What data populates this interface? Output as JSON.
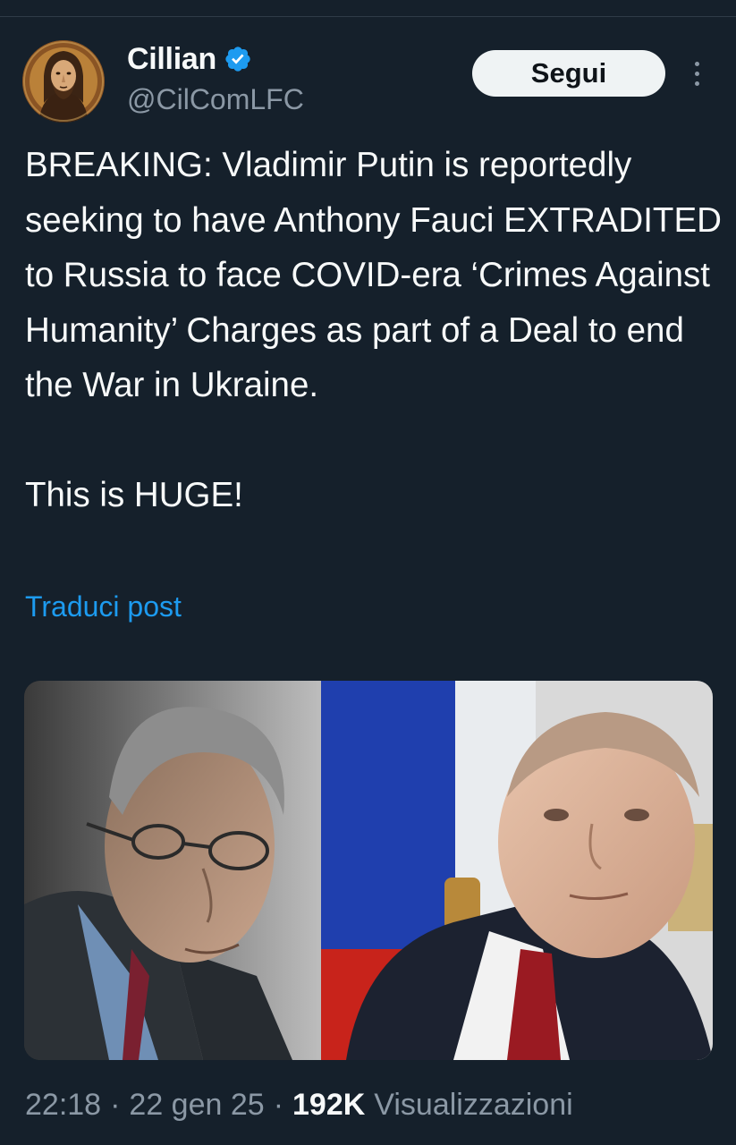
{
  "author": {
    "display_name": "Cillian",
    "handle": "@CilComLFC",
    "verified": true
  },
  "actions": {
    "follow_label": "Segui"
  },
  "post": {
    "text": "BREAKING: Vladimir Putin is reportedly seeking to have Anthony Fauci EXTRADITED to Russia to face COVID-era ‘Crimes Against Humanity’ Charges as part of a Deal to end the War in Ukraine.\n\nThis is HUGE!",
    "translate_label": "Traduci post"
  },
  "meta": {
    "time": "22:18",
    "date": "22 gen 25",
    "views_count": "192K",
    "views_label": "Visualizzazioni",
    "separator": "·"
  },
  "colors": {
    "background": "#15202b",
    "text_primary": "#f7f9f9",
    "text_secondary": "#8b98a5",
    "accent": "#1d9bf0",
    "button_bg": "#eff3f4"
  },
  "icons": {
    "verified": "verified-badge-icon",
    "more": "more-options-icon"
  }
}
